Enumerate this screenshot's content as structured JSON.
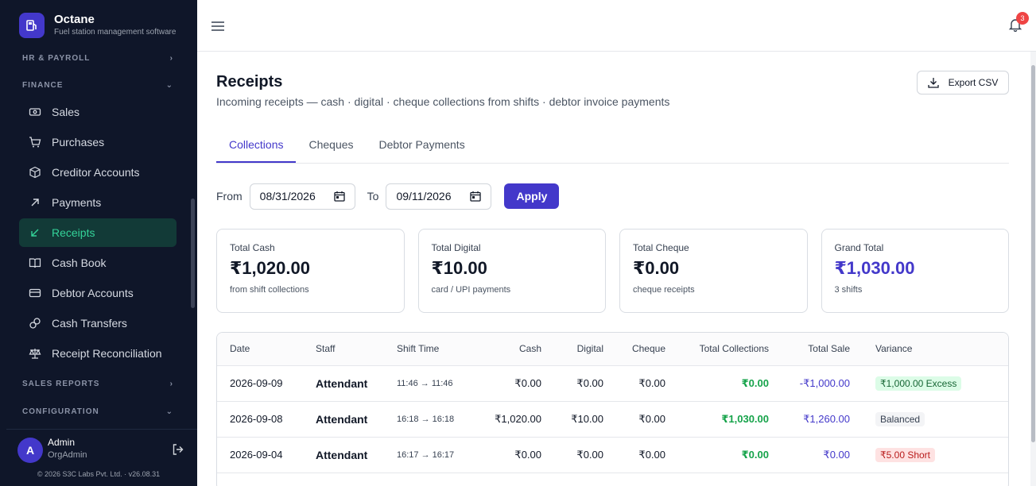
{
  "brand": {
    "name": "Octane",
    "subtitle": "Fuel station management software"
  },
  "sidebar": {
    "sections": {
      "hr": "HR & PAYROLL",
      "finance": "FINANCE",
      "sales_reports": "SALES REPORTS",
      "configuration": "CONFIGURATION"
    },
    "items": [
      {
        "label": "Sales",
        "icon": "cash-icon",
        "active": false
      },
      {
        "label": "Purchases",
        "icon": "cart-icon",
        "active": false
      },
      {
        "label": "Creditor Accounts",
        "icon": "box-icon",
        "active": false
      },
      {
        "label": "Payments",
        "icon": "arrow-up-right-icon",
        "active": false
      },
      {
        "label": "Receipts",
        "icon": "arrow-down-left-icon",
        "active": true
      },
      {
        "label": "Cash Book",
        "icon": "book-icon",
        "active": false
      },
      {
        "label": "Debtor Accounts",
        "icon": "card-icon",
        "active": false
      },
      {
        "label": "Cash Transfers",
        "icon": "transfer-icon",
        "active": false
      },
      {
        "label": "Receipt Reconciliation",
        "icon": "scale-icon",
        "active": false
      }
    ]
  },
  "user": {
    "initial": "A",
    "name": "Admin",
    "role": "OrgAdmin"
  },
  "footer": "© 2026 S3C Labs Pvt. Ltd. · v26.08.31",
  "header": {
    "notification_count": "3"
  },
  "page": {
    "title": "Receipts",
    "subtitle": "Incoming receipts — cash · digital · cheque collections from shifts · debtor invoice payments",
    "export_label": "Export CSV"
  },
  "tabs": [
    {
      "label": "Collections",
      "active": true
    },
    {
      "label": "Cheques",
      "active": false
    },
    {
      "label": "Debtor Payments",
      "active": false
    }
  ],
  "filter": {
    "from_label": "From",
    "from_value": "08/31/2026",
    "to_label": "To",
    "to_value": "09/11/2026",
    "apply_label": "Apply"
  },
  "cards": [
    {
      "label": "Total Cash",
      "value": "₹1,020.00",
      "note": "from shift collections"
    },
    {
      "label": "Total Digital",
      "value": "₹10.00",
      "note": "card / UPI payments"
    },
    {
      "label": "Total Cheque",
      "value": "₹0.00",
      "note": "cheque receipts"
    },
    {
      "label": "Grand Total",
      "value": "₹1,030.00",
      "note": "3 shifts"
    }
  ],
  "table": {
    "headers": [
      "Date",
      "Staff",
      "Shift Time",
      "Cash",
      "Digital",
      "Cheque",
      "Total Collections",
      "Total Sale",
      "Variance"
    ],
    "rows": [
      {
        "date": "2026-09-09",
        "staff": "Attendant",
        "shift": "11:46 → 11:46",
        "cash": "₹0.00",
        "digital": "₹0.00",
        "cheque": "₹0.00",
        "total": "₹0.00",
        "sale": "-₹1,000.00",
        "variance": "₹1,000.00 Excess",
        "variance_type": "excess"
      },
      {
        "date": "2026-09-08",
        "staff": "Attendant",
        "shift": "16:18 → 16:18",
        "cash": "₹1,020.00",
        "digital": "₹10.00",
        "cheque": "₹0.00",
        "total": "₹1,030.00",
        "sale": "₹1,260.00",
        "variance": "Balanced",
        "variance_type": "balanced"
      },
      {
        "date": "2026-09-04",
        "staff": "Attendant",
        "shift": "16:17 → 16:17",
        "cash": "₹0.00",
        "digital": "₹0.00",
        "cheque": "₹0.00",
        "total": "₹0.00",
        "sale": "₹0.00",
        "variance": "₹5.00 Short",
        "variance_type": "short"
      }
    ]
  },
  "colors": {
    "accent": "#4338ca",
    "sidebar_bg": "#0f1629",
    "active_green": "#34d399"
  }
}
